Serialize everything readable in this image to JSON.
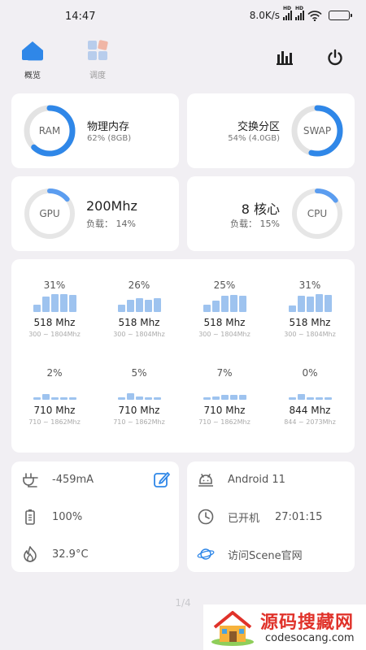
{
  "status": {
    "time": "14:47",
    "speed": "8.0K/s",
    "hd1": "HD",
    "hd2": "HD"
  },
  "nav": {
    "tab_overview": "概览",
    "tab_schedule": "调度",
    "charts_icon": "bar-chart-icon",
    "power_icon": "power-icon"
  },
  "ram": {
    "label": "RAM",
    "title": "物理内存",
    "detail": "62% (8GB)",
    "percent": 62
  },
  "swap": {
    "label": "SWAP",
    "title": "交换分区",
    "detail": "54% (4.0GB)",
    "percent": 54
  },
  "gpu": {
    "label": "GPU",
    "freq": "200Mhz",
    "load": "负载： 14%",
    "percent": 14
  },
  "cpu": {
    "label": "CPU",
    "cores": "8 核心",
    "load": "负载： 15%",
    "percent": 15
  },
  "cores": [
    {
      "pct": "31%",
      "freq": "518 Mhz",
      "range": "300 ~ 1804Mhz",
      "bars": [
        0.4,
        0.85,
        1.0,
        1.0,
        0.95
      ]
    },
    {
      "pct": "26%",
      "freq": "518 Mhz",
      "range": "300 ~ 1804Mhz",
      "bars": [
        0.4,
        0.7,
        0.75,
        0.7,
        0.75
      ]
    },
    {
      "pct": "25%",
      "freq": "518 Mhz",
      "range": "300 ~ 1804Mhz",
      "bars": [
        0.4,
        0.65,
        0.9,
        0.95,
        0.9
      ]
    },
    {
      "pct": "31%",
      "freq": "518 Mhz",
      "range": "300 ~ 1804Mhz",
      "bars": [
        0.35,
        0.9,
        0.85,
        1.0,
        0.95
      ]
    },
    {
      "pct": "2%",
      "freq": "710 Mhz",
      "range": "710 ~ 1862Mhz",
      "bars": [
        0.15,
        0.3,
        0.15,
        0.15,
        0.12
      ]
    },
    {
      "pct": "5%",
      "freq": "710 Mhz",
      "range": "710 ~ 1862Mhz",
      "bars": [
        0.15,
        0.35,
        0.2,
        0.15,
        0.15
      ]
    },
    {
      "pct": "7%",
      "freq": "710 Mhz",
      "range": "710 ~ 1862Mhz",
      "bars": [
        0.15,
        0.2,
        0.25,
        0.25,
        0.25
      ]
    },
    {
      "pct": "0%",
      "freq": "844 Mhz",
      "range": "844 ~ 2073Mhz",
      "bars": [
        0.1,
        0.3,
        0.12,
        0.12,
        0.12
      ]
    }
  ],
  "battery": {
    "current": "-459mA",
    "level": "100%",
    "temp": "32.9°C"
  },
  "system": {
    "android": "Android 11",
    "uptime_label": "已开机",
    "uptime": "27:01:15",
    "website": "访问Scene官网"
  },
  "pager": "1/4",
  "watermark": {
    "title": "源码搜藏网",
    "url": "codesocang.com"
  },
  "colors": {
    "accent": "#2f87e8",
    "ring_track": "#e3e3e3",
    "bar": "#9ec3ef",
    "brand_red": "#e0322a"
  }
}
